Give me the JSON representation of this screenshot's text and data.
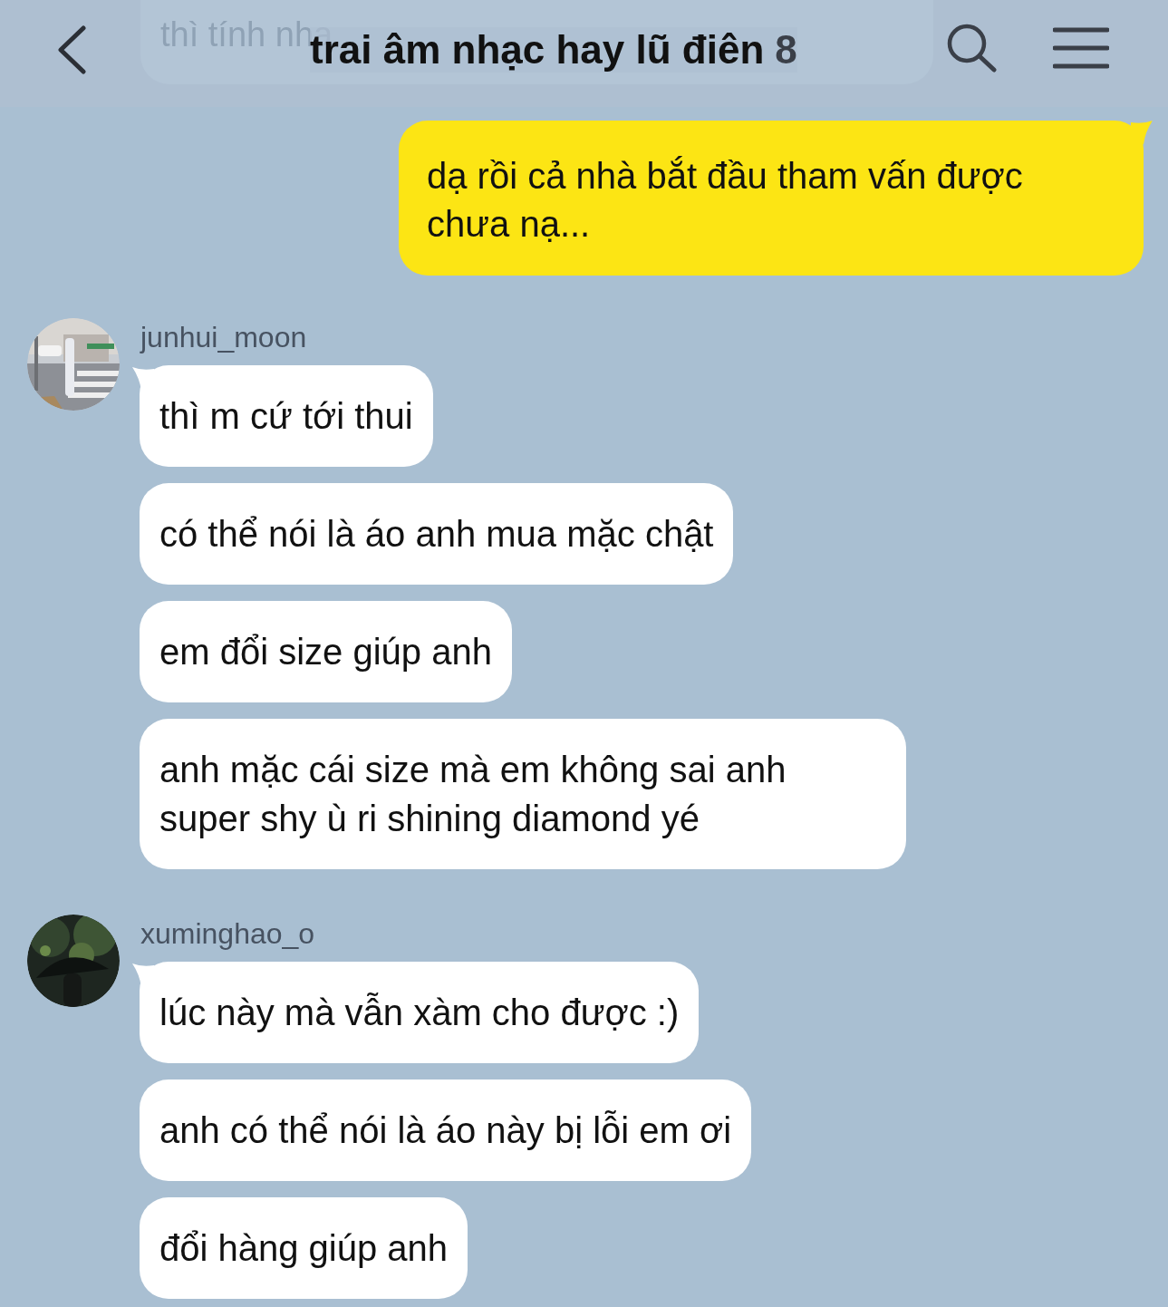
{
  "header": {
    "title": "trai âm nhạc hay lũ điên",
    "member_count": "8",
    "behind_preview": "thì tính nha"
  },
  "outgoing": [
    {
      "text": "dạ rồi cả nhà bắt đầu tham vấn được chưa nạ..."
    }
  ],
  "groups": [
    {
      "sender": "junhui_moon",
      "messages": [
        "thì m cứ tới thui",
        "có thể nói là áo anh mua mặc chật",
        "em đổi size giúp anh",
        "anh mặc cái size mà em không sai anh super shy ù ri shining diamond yé"
      ]
    },
    {
      "sender": "xuminghao_o",
      "messages": [
        "lúc này mà vẫn xàm cho được :)",
        "anh có thể nói là áo này bị lỗi em ơi",
        "đổi hàng giúp anh"
      ]
    }
  ]
}
